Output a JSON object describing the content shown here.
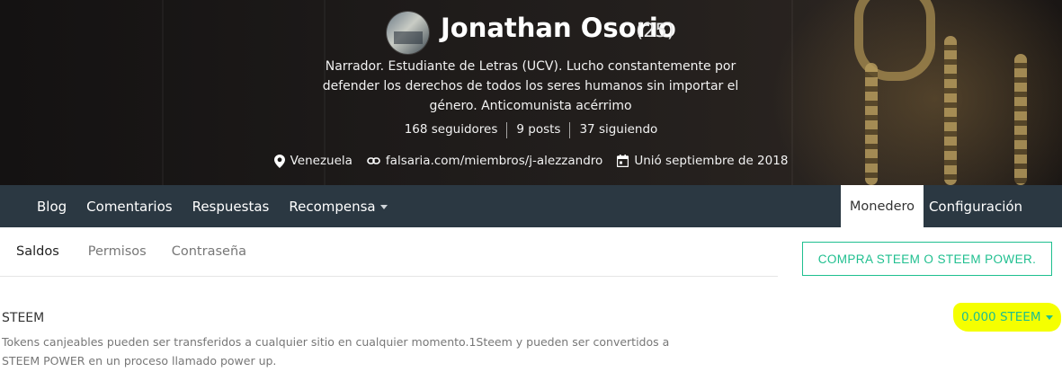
{
  "profile": {
    "name": "Jonathan Osorio",
    "reputation": "(25)",
    "about": "Narrador. Estudiante de Letras (UCV). Lucho constantemente por defender los derechos de todos los seres humanos sin importar el género. Anticomunista acérrimo",
    "stats": {
      "followers": "168 seguidores",
      "posts": "9 posts",
      "following": "37 siguiendo"
    },
    "location": "Venezuela",
    "website": "falsaria.com/miembros/j-alezzandro",
    "joined": "Unió septiembre de 2018"
  },
  "nav": {
    "items": [
      {
        "label": "Blog"
      },
      {
        "label": "Comentarios"
      },
      {
        "label": "Respuestas"
      },
      {
        "label": "Recompensa"
      }
    ],
    "active_tab": "Monedero",
    "settings_tab": "Configuración"
  },
  "wallet": {
    "subtabs": [
      {
        "label": "Saldos",
        "active": true
      },
      {
        "label": "Permisos",
        "active": false
      },
      {
        "label": "Contraseña",
        "active": false
      }
    ],
    "buy_button": "COMPRA STEEM O STEEM POWER.",
    "steem": {
      "title": "STEEM",
      "description": "Tokens canjeables pueden ser transferidos a cualquier sitio en cualquier momento.1Steem y pueden ser convertidos a STEEM POWER en un proceso llamado power up.",
      "balance": "0.000 STEEM"
    }
  },
  "colors": {
    "navbar": "#2b3842",
    "accent": "#1fbf8f",
    "highlight": "#f5ff00"
  },
  "icons": [
    "location-pin-icon",
    "link-icon",
    "calendar-icon",
    "caret-down-icon"
  ]
}
